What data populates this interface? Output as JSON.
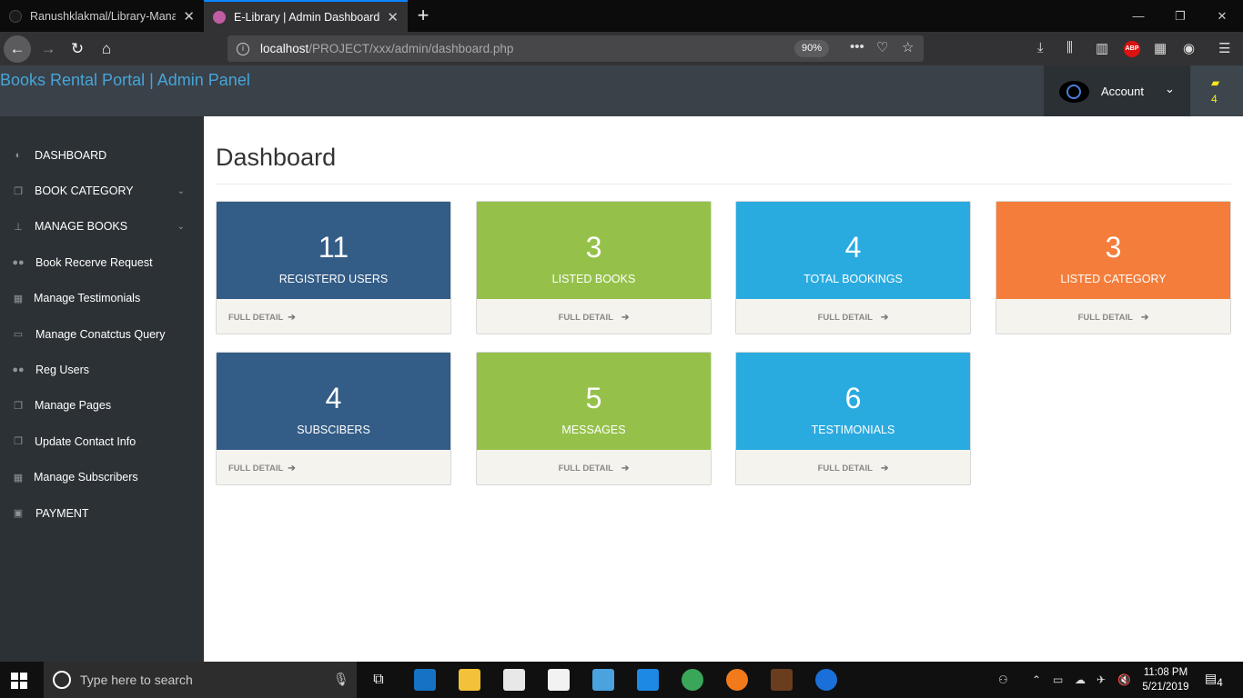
{
  "browser": {
    "tabs": [
      {
        "title": "Ranushklakmal/Library-Manag",
        "active": false
      },
      {
        "title": "E-Library | Admin Dashboard",
        "active": true
      }
    ],
    "url_host": "localhost",
    "url_path": "/PROJECT/xxx/admin/dashboard.php",
    "zoom": "90%",
    "adblock_badge": "ABP"
  },
  "header": {
    "brand": "Books Rental Portal | Admin Panel",
    "account_label": "Account",
    "notification_count": "4"
  },
  "sidebar": {
    "items": [
      {
        "label": "DASHBOARD",
        "icon": "dashboard-icon",
        "has_submenu": false
      },
      {
        "label": "BOOK CATEGORY",
        "icon": "files-icon",
        "has_submenu": true
      },
      {
        "label": "MANAGE BOOKS",
        "icon": "sitemap-icon",
        "has_submenu": true
      },
      {
        "label": "Book Recerve Request",
        "icon": "users-icon",
        "has_submenu": false
      },
      {
        "label": "Manage Testimonials",
        "icon": "table-icon",
        "has_submenu": false
      },
      {
        "label": "Manage Conatctus Query",
        "icon": "desktop-icon",
        "has_submenu": false
      },
      {
        "label": "Reg Users",
        "icon": "users-icon",
        "has_submenu": false
      },
      {
        "label": "Manage Pages",
        "icon": "files-icon",
        "has_submenu": false
      },
      {
        "label": "Update Contact Info",
        "icon": "files-icon",
        "has_submenu": false
      },
      {
        "label": "Manage Subscribers",
        "icon": "table-icon",
        "has_submenu": false
      },
      {
        "label": "PAYMENT",
        "icon": "money-icon",
        "has_submenu": false
      }
    ]
  },
  "main": {
    "title": "Dashboard",
    "footer_label": "FULL DETAIL",
    "cards": [
      {
        "value": "11",
        "label": "REGISTERD USERS",
        "color": "#335c86"
      },
      {
        "value": "3",
        "label": "LISTED BOOKS",
        "color": "#95c14a"
      },
      {
        "value": "4",
        "label": "TOTAL BOOKINGS",
        "color": "#2aabe0"
      },
      {
        "value": "3",
        "label": "LISTED CATEGORY",
        "color": "#f47d3b"
      },
      {
        "value": "4",
        "label": "SUBSCIBERS",
        "color": "#335c86"
      },
      {
        "value": "5",
        "label": "MESSAGES",
        "color": "#95c14a"
      },
      {
        "value": "6",
        "label": "TESTIMONIALS",
        "color": "#2aabe0"
      }
    ]
  },
  "taskbar": {
    "search_placeholder": "Type here to search",
    "time": "11:08 PM",
    "date": "5/21/2019",
    "notification_count": "4"
  },
  "colors": {
    "sidebar_bg": "#2c3136",
    "header_bg": "#3a4149",
    "brand": "#46a5d8"
  }
}
